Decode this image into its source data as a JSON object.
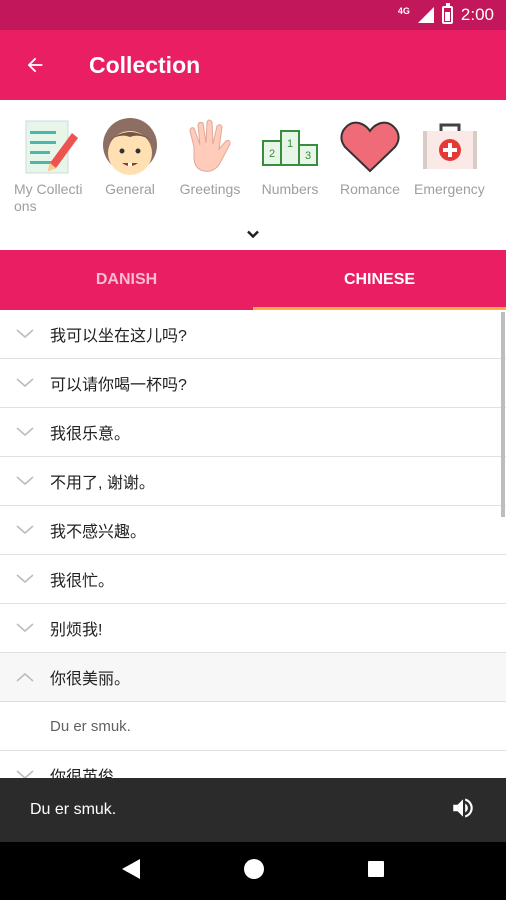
{
  "status_bar": {
    "network": "4G",
    "time": "2:00"
  },
  "app_bar": {
    "title": "Collection",
    "back_icon": "arrow-back-icon"
  },
  "categories": [
    {
      "label": "My Collections",
      "icon": "notebook-pencil-icon"
    },
    {
      "label": "General",
      "icon": "face-icon"
    },
    {
      "label": "Greetings",
      "icon": "hand-wave-icon"
    },
    {
      "label": "Numbers",
      "icon": "podium-numbers-icon"
    },
    {
      "label": "Romance",
      "icon": "heart-icon"
    },
    {
      "label": "Emergency",
      "icon": "first-aid-kit-icon"
    }
  ],
  "tabs": [
    {
      "label": "DANISH",
      "active": false
    },
    {
      "label": "CHINESE",
      "active": true
    }
  ],
  "phrases": [
    {
      "text": "我可以坐在这儿吗?",
      "expanded": false
    },
    {
      "text": "可以请你喝一杯吗?",
      "expanded": false
    },
    {
      "text": "我很乐意。",
      "expanded": false
    },
    {
      "text": "不用了, 谢谢。",
      "expanded": false
    },
    {
      "text": "我不感兴趣。",
      "expanded": false
    },
    {
      "text": "我很忙。",
      "expanded": false
    },
    {
      "text": "别烦我!",
      "expanded": false
    },
    {
      "text": "你很美丽。",
      "expanded": true
    },
    {
      "text": "Du er smuk.",
      "answer": true
    },
    {
      "text": "你很英俊。",
      "expanded": false
    }
  ],
  "player": {
    "text": "Du er smuk.",
    "icon": "speaker-icon"
  },
  "colors": {
    "primary": "#e91e63",
    "primary_dark": "#c2185b",
    "accent": "#ffab40"
  }
}
